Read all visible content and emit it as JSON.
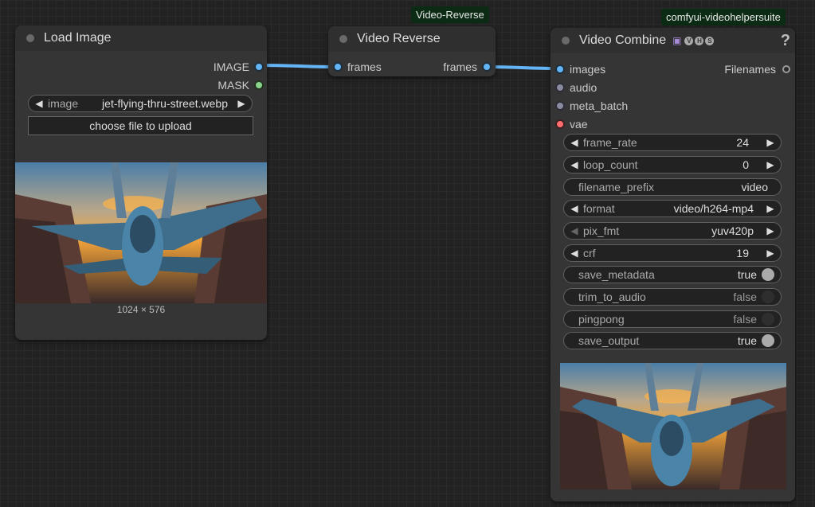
{
  "badges": {
    "video_reverse": "Video-Reverse",
    "video_combine": "comfyui-videohelpersuite"
  },
  "load_image": {
    "title": "Load Image",
    "outputs": [
      "IMAGE",
      "MASK"
    ],
    "image_widget": {
      "label": "image",
      "value": "jet-flying-thru-street.webp"
    },
    "upload_button": "choose file to upload",
    "image_size": "1024 × 576"
  },
  "video_reverse": {
    "title": "Video Reverse",
    "input": "frames",
    "output": "frames"
  },
  "video_combine": {
    "title": "Video Combine",
    "help": "?",
    "badge_letters": [
      "V",
      "H",
      "S"
    ],
    "inputs": [
      "images",
      "audio",
      "meta_batch",
      "vae"
    ],
    "output": "Filenames",
    "widgets": [
      {
        "label": "frame_rate",
        "value": "24"
      },
      {
        "label": "loop_count",
        "value": "0"
      },
      {
        "label": "filename_prefix",
        "value": "video"
      },
      {
        "label": "format",
        "value": "video/h264-mp4"
      },
      {
        "label": "pix_fmt",
        "value": "yuv420p"
      },
      {
        "label": "crf",
        "value": "19"
      },
      {
        "label": "save_metadata",
        "value": "true"
      },
      {
        "label": "trim_to_audio",
        "value": "false"
      },
      {
        "label": "pingpong",
        "value": "false"
      },
      {
        "label": "save_output",
        "value": "true"
      }
    ]
  },
  "colors": {
    "link": "#64b5f6",
    "image_slot": "#64b5f6",
    "mask_slot": "#8bd48b",
    "vae_slot": "#ff6e6e",
    "badge_bg": "#0c2b14"
  }
}
